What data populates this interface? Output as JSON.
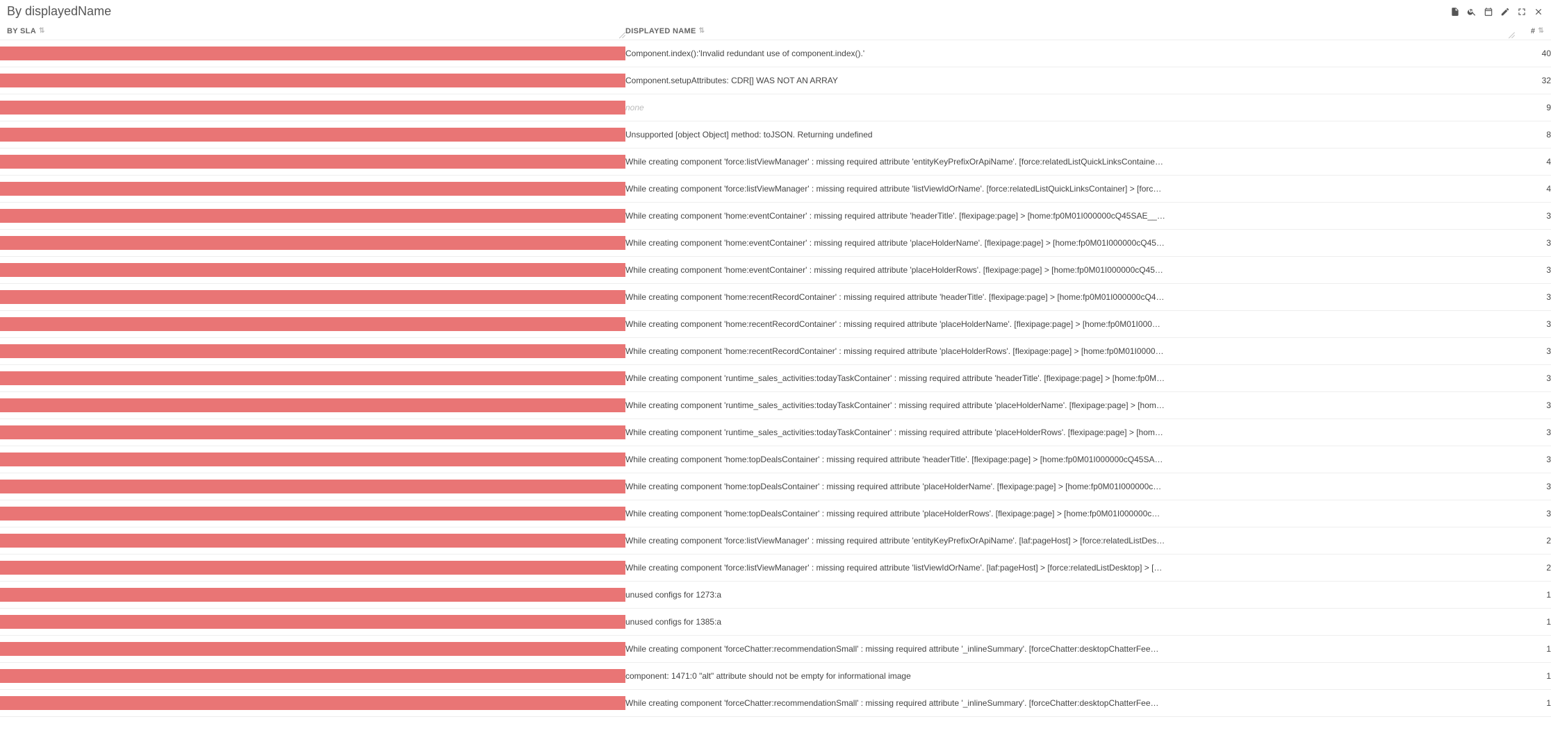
{
  "panel": {
    "title": "By displayedName"
  },
  "columns": {
    "by_sla": "BY SLA",
    "displayed_name": "DISPLAYED NAME",
    "count": "#"
  },
  "colors": {
    "bar": "#e97575"
  },
  "rows": [
    {
      "bar_pct": 100,
      "name": "Component.index():'Invalid redundant use of component.index().'",
      "count": 40
    },
    {
      "bar_pct": 100,
      "name": "Component.setupAttributes: CDR[] WAS NOT AN ARRAY",
      "count": 32
    },
    {
      "bar_pct": 100,
      "name": "none",
      "none": true,
      "count": 9
    },
    {
      "bar_pct": 100,
      "name": "Unsupported [object Object] method: toJSON. Returning undefined",
      "count": 8
    },
    {
      "bar_pct": 100,
      "name": "While creating component 'force:listViewManager' : missing required attribute 'entityKeyPrefixOrApiName'. [force:relatedListQuickLinksContaine…",
      "count": 4
    },
    {
      "bar_pct": 100,
      "name": "While creating component 'force:listViewManager' : missing required attribute 'listViewIdOrName'. [force:relatedListQuickLinksContainer] > [forc…",
      "count": 4
    },
    {
      "bar_pct": 100,
      "name": "While creating component 'home:eventContainer' : missing required attribute 'headerTitle'. [flexipage:page] > [home:fp0M01I000000cQ45SAE__…",
      "count": 3
    },
    {
      "bar_pct": 100,
      "name": "While creating component 'home:eventContainer' : missing required attribute 'placeHolderName'. [flexipage:page] > [home:fp0M01I000000cQ45…",
      "count": 3
    },
    {
      "bar_pct": 100,
      "name": "While creating component 'home:eventContainer' : missing required attribute 'placeHolderRows'. [flexipage:page] > [home:fp0M01I000000cQ45…",
      "count": 3
    },
    {
      "bar_pct": 100,
      "name": "While creating component 'home:recentRecordContainer' : missing required attribute 'headerTitle'. [flexipage:page] > [home:fp0M01I000000cQ4…",
      "count": 3
    },
    {
      "bar_pct": 100,
      "name": "While creating component 'home:recentRecordContainer' : missing required attribute 'placeHolderName'. [flexipage:page] > [home:fp0M01I000…",
      "count": 3
    },
    {
      "bar_pct": 100,
      "name": "While creating component 'home:recentRecordContainer' : missing required attribute 'placeHolderRows'. [flexipage:page] > [home:fp0M01I0000…",
      "count": 3
    },
    {
      "bar_pct": 100,
      "name": "While creating component 'runtime_sales_activities:todayTaskContainer' : missing required attribute 'headerTitle'. [flexipage:page] > [home:fp0M…",
      "count": 3
    },
    {
      "bar_pct": 100,
      "name": "While creating component 'runtime_sales_activities:todayTaskContainer' : missing required attribute 'placeHolderName'. [flexipage:page] > [hom…",
      "count": 3
    },
    {
      "bar_pct": 100,
      "name": "While creating component 'runtime_sales_activities:todayTaskContainer' : missing required attribute 'placeHolderRows'. [flexipage:page] > [hom…",
      "count": 3
    },
    {
      "bar_pct": 100,
      "name": "While creating component 'home:topDealsContainer' : missing required attribute 'headerTitle'. [flexipage:page] > [home:fp0M01I000000cQ45SA…",
      "count": 3
    },
    {
      "bar_pct": 100,
      "name": "While creating component 'home:topDealsContainer' : missing required attribute 'placeHolderName'. [flexipage:page] > [home:fp0M01I000000c…",
      "count": 3
    },
    {
      "bar_pct": 100,
      "name": "While creating component 'home:topDealsContainer' : missing required attribute 'placeHolderRows'. [flexipage:page] > [home:fp0M01I000000c…",
      "count": 3
    },
    {
      "bar_pct": 100,
      "name": "While creating component 'force:listViewManager' : missing required attribute 'entityKeyPrefixOrApiName'. [laf:pageHost] > [force:relatedListDes…",
      "count": 2
    },
    {
      "bar_pct": 100,
      "name": "While creating component 'force:listViewManager' : missing required attribute 'listViewIdOrName'. [laf:pageHost] > [force:relatedListDesktop] > […",
      "count": 2
    },
    {
      "bar_pct": 100,
      "name": "unused configs for 1273:a",
      "count": 1
    },
    {
      "bar_pct": 100,
      "name": "unused configs for 1385:a",
      "count": 1
    },
    {
      "bar_pct": 100,
      "name": "While creating component 'forceChatter:recommendationSmall' : missing required attribute '_inlineSummary'. [forceChatter:desktopChatterFee…",
      "count": 1
    },
    {
      "bar_pct": 100,
      "name": "component: 1471:0 \"alt\" attribute should not be empty for informational image",
      "count": 1
    },
    {
      "bar_pct": 100,
      "name": "While creating component 'forceChatter:recommendationSmall' : missing required attribute '_inlineSummary'. [forceChatter:desktopChatterFee…",
      "count": 1
    }
  ]
}
